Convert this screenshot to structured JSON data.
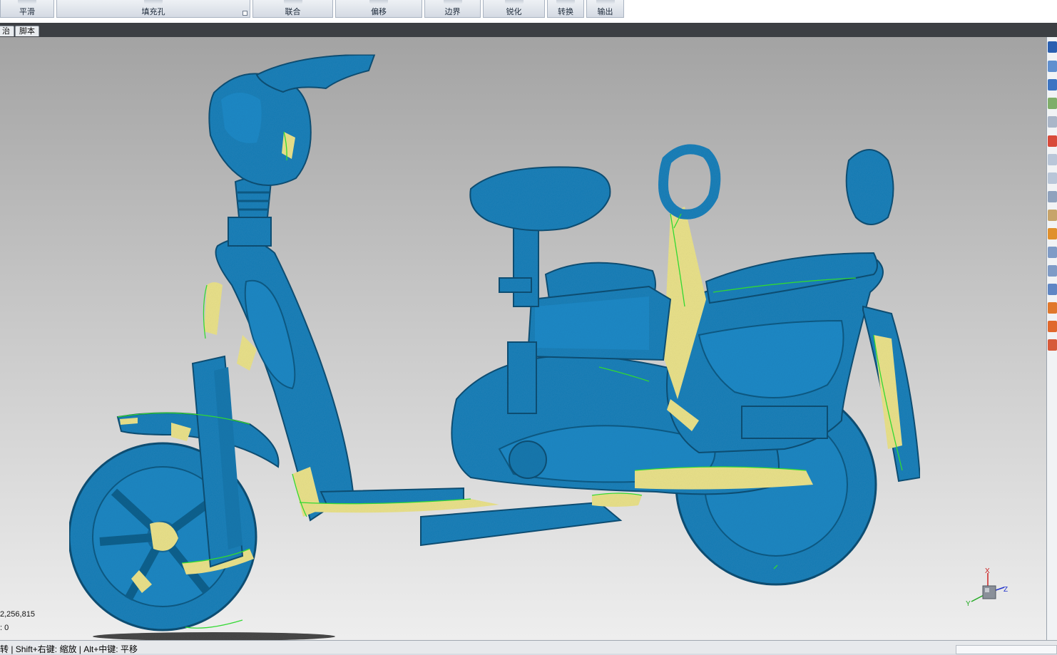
{
  "ribbon": {
    "groups": [
      {
        "label": "平滑"
      },
      {
        "label": "填充孔"
      },
      {
        "label": "联合"
      },
      {
        "label": "偏移"
      },
      {
        "label": "边界"
      },
      {
        "label": "锐化"
      },
      {
        "label": "转换"
      },
      {
        "label": "输出"
      }
    ]
  },
  "tabs": [
    {
      "label": "治"
    },
    {
      "label": "脚本"
    }
  ],
  "viewport": {
    "stat_line_1": "2,256,815",
    "stat_line_2": ": 0",
    "axis": {
      "x": "X",
      "y": "Y",
      "z": "Z"
    }
  },
  "status": {
    "hint": "转 | Shift+右键: 缩放 | Alt+中键: 平移"
  },
  "colors": {
    "mesh": "#1a7fb8",
    "highlight": "#e8e08a",
    "boundary": "#33dd33",
    "background_top": "#a3a3a3",
    "background_bottom": "#eeeeee"
  }
}
